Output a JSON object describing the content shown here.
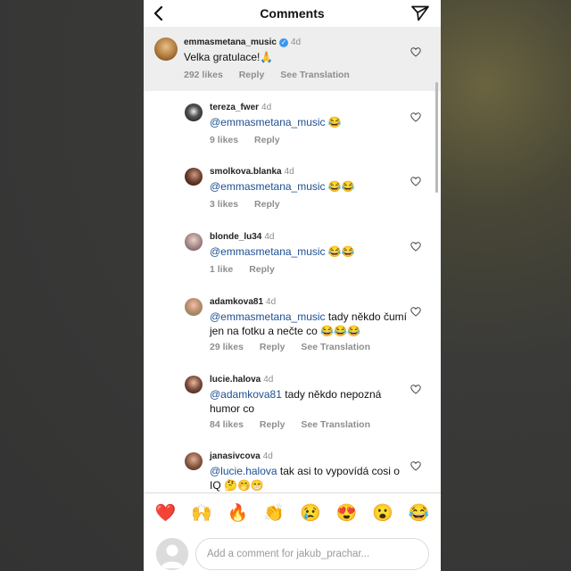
{
  "header": {
    "title": "Comments",
    "back_icon": "chevron-left-icon",
    "send_icon": "paper-plane-icon"
  },
  "comments": [
    {
      "username": "emmasmetana_music",
      "verified": true,
      "time": "4d",
      "mention": "",
      "text": "Velka gratulace!🙏",
      "likes": "292 likes",
      "reply": "Reply",
      "translate": "See Translation"
    },
    {
      "username": "tereza_fwer",
      "time": "4d",
      "mention": "@emmasmetana_music",
      "text": " 😂",
      "likes": "9 likes",
      "reply": "Reply",
      "translate": ""
    },
    {
      "username": "smolkova.blanka",
      "time": "4d",
      "mention": "@emmasmetana_music",
      "text": " 😂😂",
      "likes": "3 likes",
      "reply": "Reply",
      "translate": ""
    },
    {
      "username": "blonde_lu34",
      "time": "4d",
      "mention": "@emmasmetana_music",
      "text": " 😂😂",
      "likes": "1 like",
      "reply": "Reply",
      "translate": ""
    },
    {
      "username": "adamkova81",
      "time": "4d",
      "mention": "@emmasmetana_music",
      "text": " tady někdo čumí jen na fotku a nečte co 😂😂😂",
      "likes": "29 likes",
      "reply": "Reply",
      "translate": "See Translation"
    },
    {
      "username": "lucie.halova",
      "time": "4d",
      "mention": "@adamkova81",
      "text": " tady někdo nepozná humor co",
      "likes": "84 likes",
      "reply": "Reply",
      "translate": "See Translation"
    },
    {
      "username": "janasivcova",
      "time": "4d",
      "mention": "@lucie.halova",
      "text": " tak asi to vypovídá cosi o  IQ 🤔🤭😁",
      "likes": "",
      "reply": "",
      "translate": ""
    }
  ],
  "reactions": [
    "❤️",
    "🙌",
    "🔥",
    "👏",
    "😢",
    "😍",
    "😮",
    "😂"
  ],
  "compose": {
    "placeholder": "Add a comment for jakub_prachar..."
  },
  "colors": {
    "mention": "#1d4f91",
    "verified": "#3897f0",
    "meta": "#8e8e8e"
  }
}
